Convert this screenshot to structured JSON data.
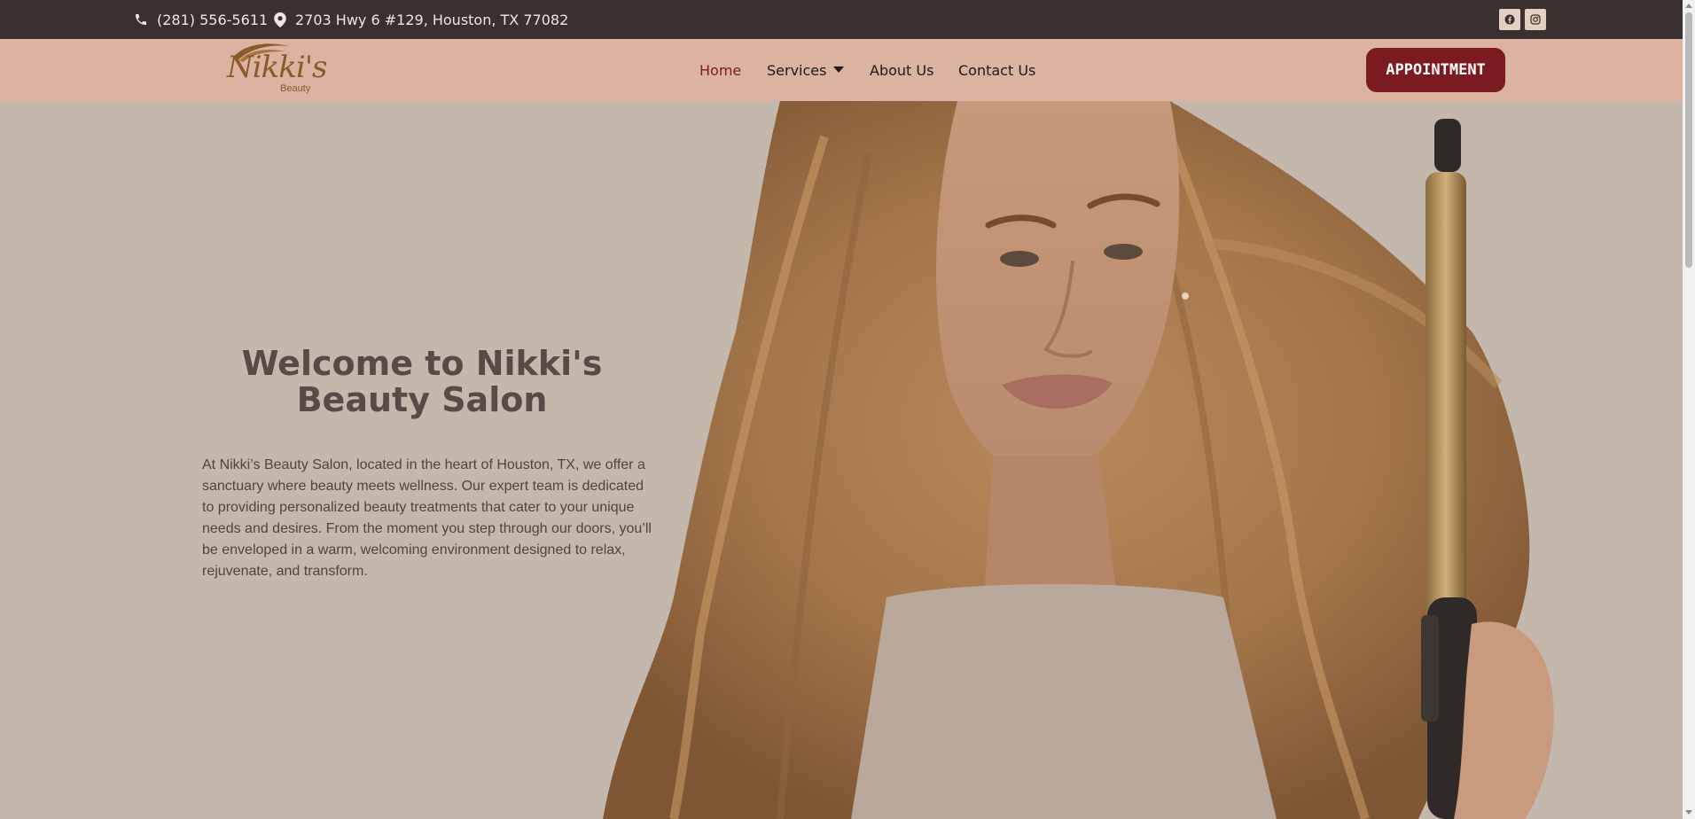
{
  "topbar": {
    "phone": "(281) 556-5611",
    "address": "2703 Hwy 6 #129, Houston, TX 77082",
    "icons": [
      "phone-icon",
      "location-pin-icon",
      "facebook-icon",
      "instagram-icon"
    ]
  },
  "logo": {
    "script": "Nikki's",
    "subtitle": "Beauty"
  },
  "nav": {
    "home": "Home",
    "services": "Services",
    "about": "About Us",
    "contact": "Contact Us",
    "active": "Home"
  },
  "cta": {
    "appointment": "APPOINTMENT"
  },
  "hero": {
    "title": "Welcome to Nikki's Beauty Salon",
    "body": "At Nikki’s Beauty Salon, located in the heart of Houston, TX, we offer a sanctuary where beauty meets wellness. Our expert team is dedicated to providing personalized beauty treatments that cater to your unique needs and desires. From the moment you step through our doors, you’ll be enveloped in a warm, welcoming environment designed to relax, rejuvenate, and transform."
  },
  "colors": {
    "topbar": "#3a302f",
    "header": "#dcb2a1",
    "accent": "#7c1a22",
    "hero_bg": "#c4b7ac"
  }
}
